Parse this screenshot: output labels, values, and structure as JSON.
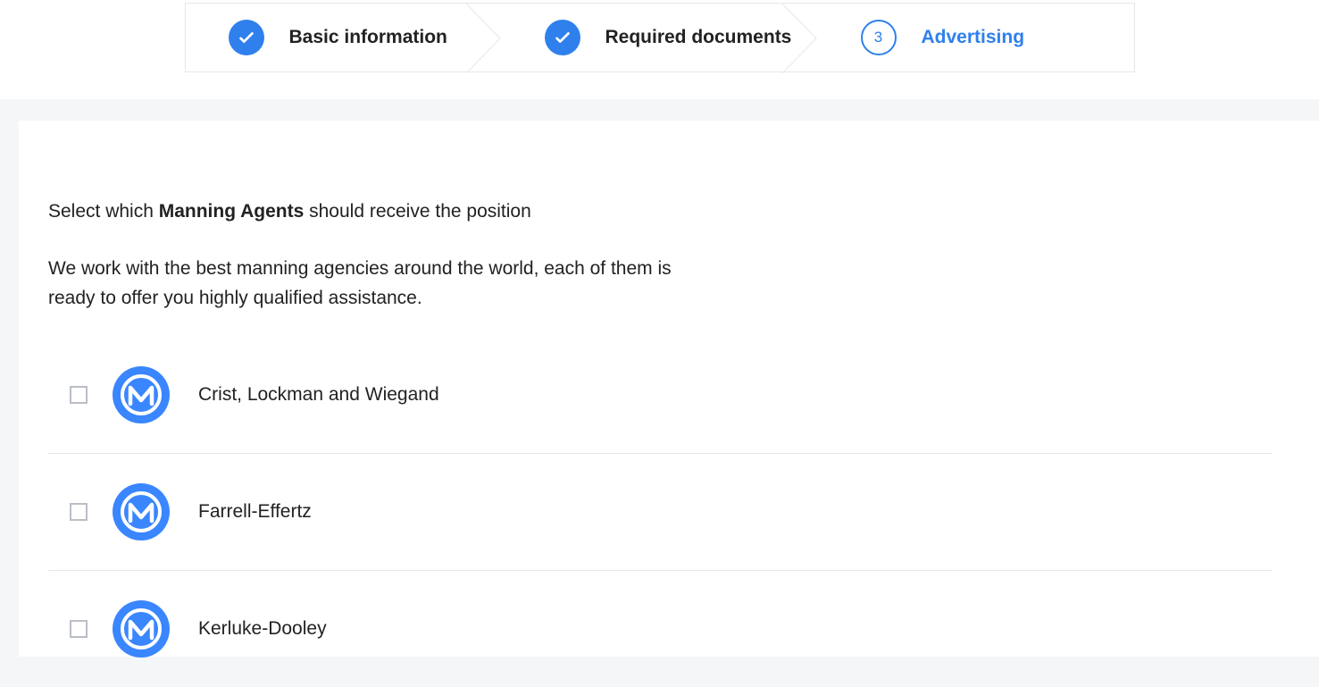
{
  "stepper": {
    "steps": [
      {
        "label": "Basic information",
        "state": "done"
      },
      {
        "label": "Required documents",
        "state": "done"
      },
      {
        "label": "Advertising",
        "state": "current",
        "number": "3"
      }
    ]
  },
  "intro": {
    "prefix": "Select which ",
    "bold": "Manning Agents",
    "suffix": " should receive the position",
    "description": "We work with the best manning agencies around the world, each of them is ready to offer you highly qualified assistance."
  },
  "agents": [
    {
      "name": "Crist, Lockman and Wiegand",
      "checked": false
    },
    {
      "name": "Farrell-Effertz",
      "checked": false
    },
    {
      "name": "Kerluke-Dooley",
      "checked": false
    }
  ]
}
